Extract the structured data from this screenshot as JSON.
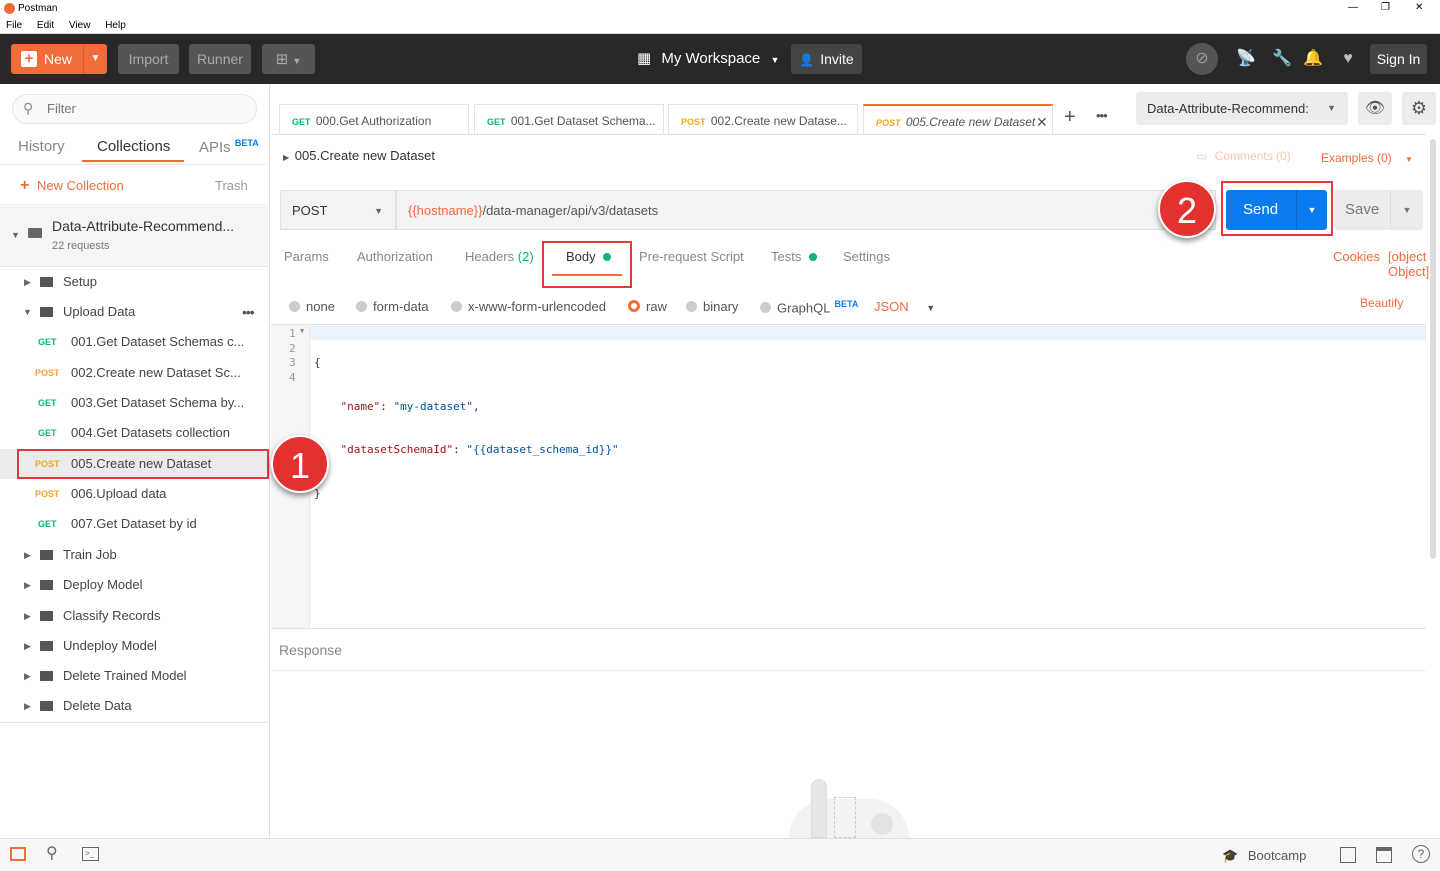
{
  "window": {
    "title": "Postman",
    "controls": [
      "—",
      "❐",
      "✕"
    ]
  },
  "menu": [
    "File",
    "Edit",
    "View",
    "Help"
  ],
  "topbar": {
    "new_label": "New",
    "import_label": "Import",
    "runner_label": "Runner",
    "workspace_label": "My Workspace",
    "invite_label": "Invite",
    "signin_label": "Sign In"
  },
  "sidebar": {
    "filter_placeholder": "Filter",
    "tabs": {
      "history": "History",
      "collections": "Collections",
      "apis": "APIs",
      "apis_badge": "BETA"
    },
    "new_collection": "New Collection",
    "trash": "Trash",
    "collection": {
      "name": "Data-Attribute-Recommend...",
      "count": "22 requests"
    },
    "folders_top": [
      {
        "label": "Setup"
      }
    ],
    "upload_folder": "Upload Data",
    "requests": [
      {
        "method": "GET",
        "label": "001.Get Dataset Schemas c..."
      },
      {
        "method": "POST",
        "label": "002.Create new Dataset Sc..."
      },
      {
        "method": "GET",
        "label": "003.Get Dataset Schema by..."
      },
      {
        "method": "GET",
        "label": "004.Get Datasets collection"
      },
      {
        "method": "POST",
        "label": "005.Create new Dataset"
      },
      {
        "method": "POST",
        "label": "006.Upload data"
      },
      {
        "method": "GET",
        "label": "007.Get Dataset by id"
      }
    ],
    "folders_bottom": [
      "Train Job",
      "Deploy Model",
      "Classify Records",
      "Undeploy Model",
      "Delete Trained Model",
      "Delete Data"
    ]
  },
  "tabs": [
    {
      "method": "GET",
      "label": "000.Get Authorization"
    },
    {
      "method": "GET",
      "label": "001.Get Dataset Schema..."
    },
    {
      "method": "POST",
      "label": "002.Create new Datase..."
    },
    {
      "method": "POST",
      "label": "005.Create new Dataset"
    }
  ],
  "env": {
    "selected": "Data-Attribute-Recommend:"
  },
  "request": {
    "name": "005.Create new Dataset",
    "comments": "Comments (0)",
    "examples": "Examples (0)",
    "method": "POST",
    "url_var": "{{hostname}}",
    "url_path": "/data-manager/api/v3/datasets",
    "send_label": "Send",
    "save_label": "Save",
    "tabs": {
      "params": "Params",
      "auth": "Authorization",
      "headers": "Headers",
      "headers_count": "(2)",
      "body": "Body",
      "prerequest": "Pre-request Script",
      "tests": "Tests",
      "settings": "Settings"
    },
    "cookies": "Cookies",
    "code": {
      "open": "{",
      "key1": "\"name\"",
      "val1": "\"my-dataset\"",
      "key2": "\"datasetSchemaId\"",
      "val2": "\"{{dataset_schema_id}}\"",
      "close": "}"
    },
    "body_modes": {
      "none": "none",
      "form_data": "form-data",
      "urlencoded": "x-www-form-urlencoded",
      "raw": "raw",
      "binary": "binary",
      "graphql": "GraphQL",
      "graphql_badge": "BETA",
      "format": "JSON"
    },
    "beautify": "Beautify",
    "code_lines": [
      "1",
      "2",
      "3",
      "4"
    ]
  },
  "response": {
    "label": "Response"
  },
  "annotations": {
    "one": "1",
    "two": "2"
  },
  "statusbar": {
    "bootcamp": "Bootcamp"
  },
  "colors": {
    "accent": "#f26b3a",
    "send": "#097bed",
    "annotation": "#e53030"
  }
}
